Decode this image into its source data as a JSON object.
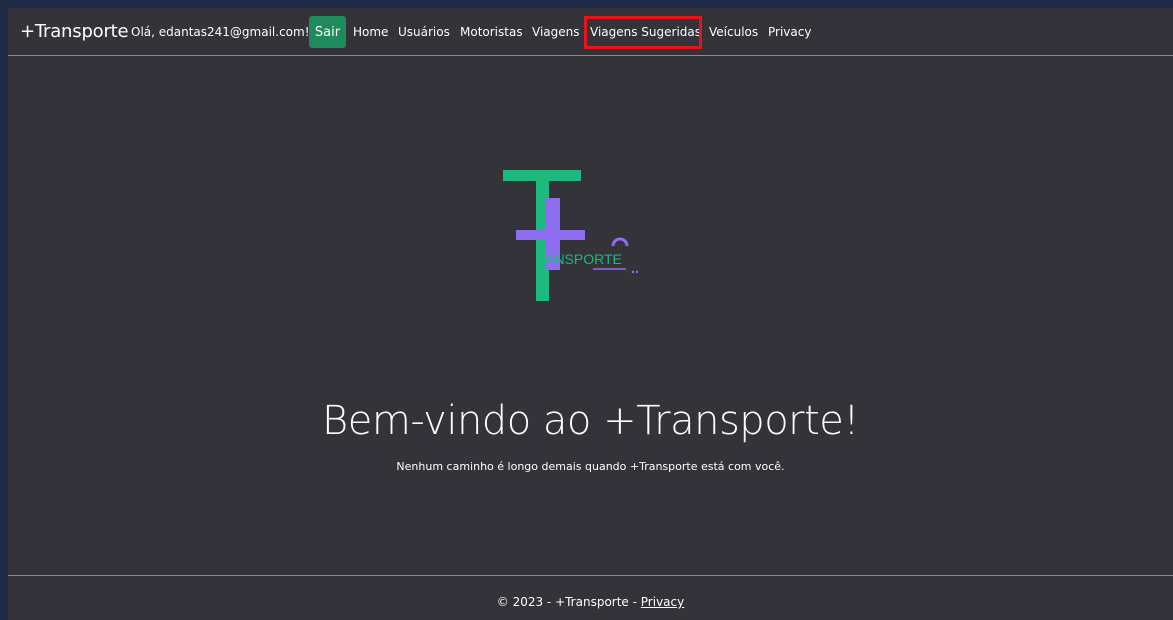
{
  "navbar": {
    "brand": "+Transporte",
    "greeting": "Olá, edantas241@gmail.com!",
    "logout_label": "Sair",
    "links": [
      {
        "label": "Home"
      },
      {
        "label": "Usuários"
      },
      {
        "label": "Motoristas"
      },
      {
        "label": "Viagens"
      },
      {
        "label": "Viagens Sugeridas",
        "highlighted": true
      },
      {
        "label": "Veículos"
      },
      {
        "label": "Privacy"
      }
    ]
  },
  "logo": {
    "text": "RANSPORTE",
    "colors": {
      "green": "#1db97f",
      "purple": "#8f6df0"
    }
  },
  "hero": {
    "title": "Bem-vindo ao +Transporte!",
    "subtitle": "Nenhum caminho é longo demais quando +Transporte está com você."
  },
  "footer": {
    "prefix": "© 2023 - +Transporte - ",
    "privacy_label": "Privacy"
  },
  "colors": {
    "background": "#333339",
    "accent_button": "#1f8a5b",
    "highlight_box": "#e8141b"
  }
}
